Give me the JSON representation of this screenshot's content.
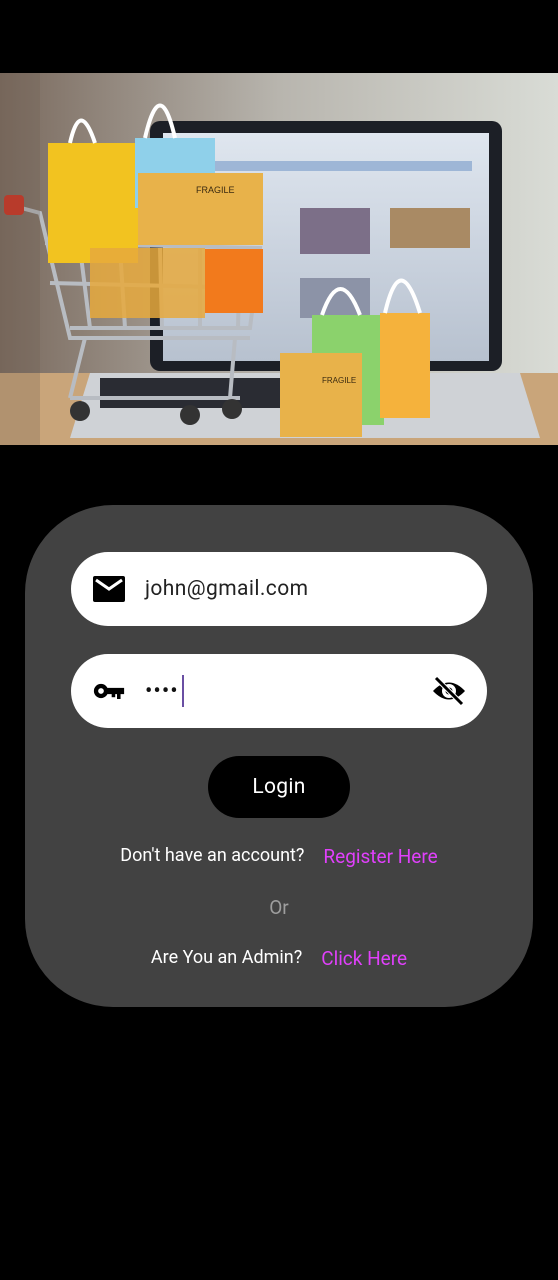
{
  "hero": {
    "image_description": "shopping cart with gift bags and parcels in front of laptop"
  },
  "login": {
    "email_value": "john@gmail.com",
    "password_value": "••••",
    "login_label": "Login",
    "no_account_text": "Don't have an account?",
    "register_link": "Register Here",
    "or_text": "Or",
    "admin_text": "Are You an Admin?",
    "admin_link": "Click Here"
  },
  "icons": {
    "email": "email-icon",
    "password": "key-icon",
    "visibility": "visibility-off-icon"
  },
  "colors": {
    "card_background": "#424242",
    "link": "#e040fb",
    "button": "#000000",
    "page_background": "#000000"
  }
}
